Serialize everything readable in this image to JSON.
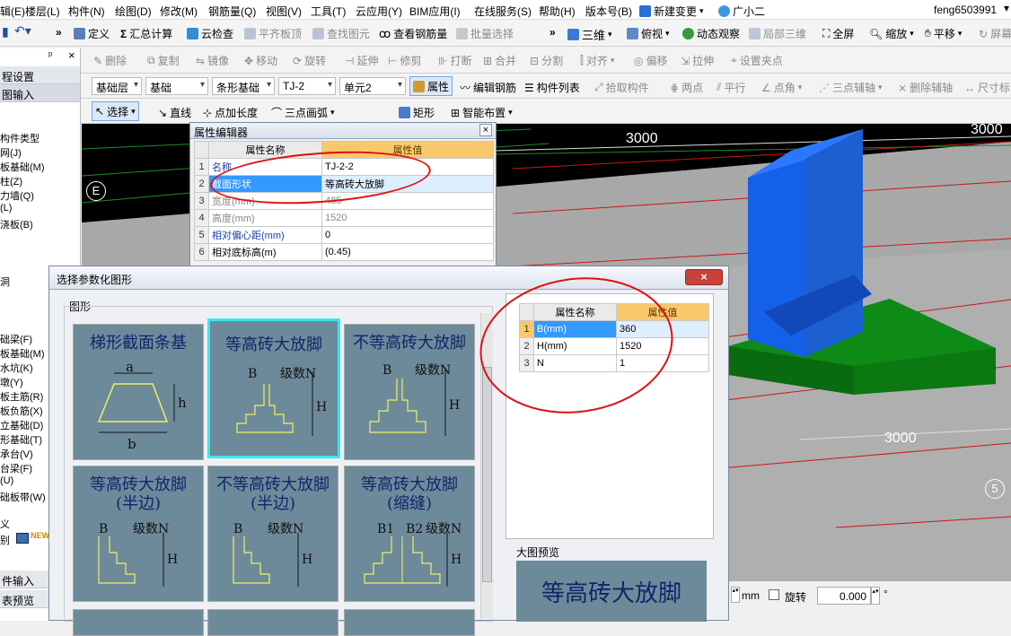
{
  "menubar": {
    "items": [
      "辑(E)",
      "楼层(L)",
      "构件(N)",
      "绘图(D)",
      "修改(M)",
      "钢筋量(Q)",
      "视图(V)",
      "工具(T)",
      "云应用(Y)",
      "BIM应用(I)",
      "在线服务(S)",
      "帮助(H)",
      "版本号(B)"
    ],
    "new_change": "新建变更",
    "assistant": "广小二",
    "user": "feng6503991"
  },
  "toolbar1": {
    "define": "定义",
    "sum": "汇总计算",
    "cloud_check": "云检查",
    "flat_top": "平齐板顶",
    "find": "查找图元",
    "view_rebar": "查看钢筋量",
    "batch_select": "批量选择",
    "three_d": "三维",
    "top_view": "俯视",
    "dynamic_view": "动态观察",
    "local_3d": "局部三维",
    "full_screen": "全屏",
    "zoom": "缩放",
    "pan": "平移",
    "screen_rotate": "屏幕"
  },
  "toolbar2": [
    "删除",
    "复制",
    "镜像",
    "移动",
    "旋转",
    "延伸",
    "修剪",
    "打断",
    "合并",
    "分割",
    "对齐",
    "偏移",
    "拉伸",
    "设置夹点"
  ],
  "toolbar3": {
    "floor": "基础层",
    "category": "基础",
    "type": "条形基础",
    "element": "TJ-2",
    "unit": "单元2",
    "property": "属性",
    "edit_rebar": "编辑钢筋",
    "component_list": "构件列表",
    "pick_component": "拾取构件",
    "two_points": "两点",
    "parallel": "平行",
    "point_angle": "点角",
    "three_point_aux": "三点辅轴",
    "delete_aux": "删除辅轴",
    "dimension": "尺寸标"
  },
  "toolbar4": {
    "select": "选择",
    "line": "直线",
    "point_length": "点加长度",
    "arc": "三点画弧",
    "rect": "矩形",
    "smart_layout": "智能布置"
  },
  "left_panel": {
    "pin": "ᵖ",
    "close": "×",
    "tab1": "程设置",
    "tab2": "图输入",
    "items_top": [
      "构件类型",
      "网(J)",
      "板基础(M)",
      "柱(Z)",
      "力墙(Q)",
      "(L)",
      "浇板(B)"
    ],
    "item_mid": "洞",
    "items_bottom": [
      "础梁(F)",
      "板基础(M)",
      "水坑(K)",
      "墩(Y)",
      "板主筋(R)",
      "板负筋(X)",
      "立基础(D)",
      "形基础(T)",
      "承台(V)",
      "台梁(F)",
      "(U)",
      "础板带(W)"
    ],
    "item_x": "义",
    "item_bie": "别",
    "new_badge": "NEW",
    "bottom1": "件输入",
    "bottom2": "表预览"
  },
  "viewport": {
    "dim_top_center": "3000",
    "dim_top_right": "3000",
    "dim_mid_right": "3000",
    "axis_e": "E",
    "axis_5": "5"
  },
  "property_editor": {
    "title": "属性编辑器",
    "col_name": "属性名称",
    "col_value": "属性值",
    "rows": [
      {
        "n": "1",
        "name": "名称",
        "value": "TJ-2-2"
      },
      {
        "n": "2",
        "name": "截面形状",
        "value": "等高砖大放脚"
      },
      {
        "n": "3",
        "name": "宽度(mm)",
        "value": "485"
      },
      {
        "n": "4",
        "name": "高度(mm)",
        "value": "1520"
      },
      {
        "n": "5",
        "name": "相对偏心距(mm)",
        "value": "0"
      },
      {
        "n": "6",
        "name": "相对底标高(m)",
        "value": "(0.45)"
      }
    ]
  },
  "param_dialog": {
    "title": "选择参数化图形",
    "group_label": "图形",
    "shapes": [
      {
        "title": "梯形截面条基",
        "labels": [
          "a",
          "h",
          "b"
        ]
      },
      {
        "title": "等高砖大放脚",
        "labels": [
          "B",
          "级数N",
          "H"
        ]
      },
      {
        "title": "不等高砖大放脚",
        "labels": [
          "B",
          "级数N",
          "H"
        ]
      },
      {
        "title": "等高砖大放脚(半边)",
        "labels": [
          "B",
          "级数N",
          "H"
        ]
      },
      {
        "title": "不等高砖大放脚(半边)",
        "labels": [
          "B",
          "级数N",
          "H"
        ]
      },
      {
        "title": "等高砖大放脚(缩缝)",
        "labels": [
          "B1",
          "B2",
          "级数N",
          "H"
        ]
      }
    ],
    "props": {
      "col_name": "属性名称",
      "col_value": "属性值",
      "rows": [
        {
          "n": "1",
          "name": "B(mm)",
          "value": "360"
        },
        {
          "n": "2",
          "name": "H(mm)",
          "value": "1520"
        },
        {
          "n": "3",
          "name": "N",
          "value": "1"
        }
      ]
    },
    "preview_label": "大图预览",
    "preview_text": "等高砖大放脚"
  },
  "status": {
    "unit": "mm",
    "rotate_label": "旋转",
    "rotate_value": "0.000",
    "degree": "°"
  },
  "colors": {
    "wall_blue": "#1560e8",
    "slab_green": "#0e8a16",
    "thumb_bg": "#6d8a9a",
    "selected_border": "#39e7f3",
    "annotation_red": "#e01010",
    "header_orange": "#f8c86a"
  }
}
